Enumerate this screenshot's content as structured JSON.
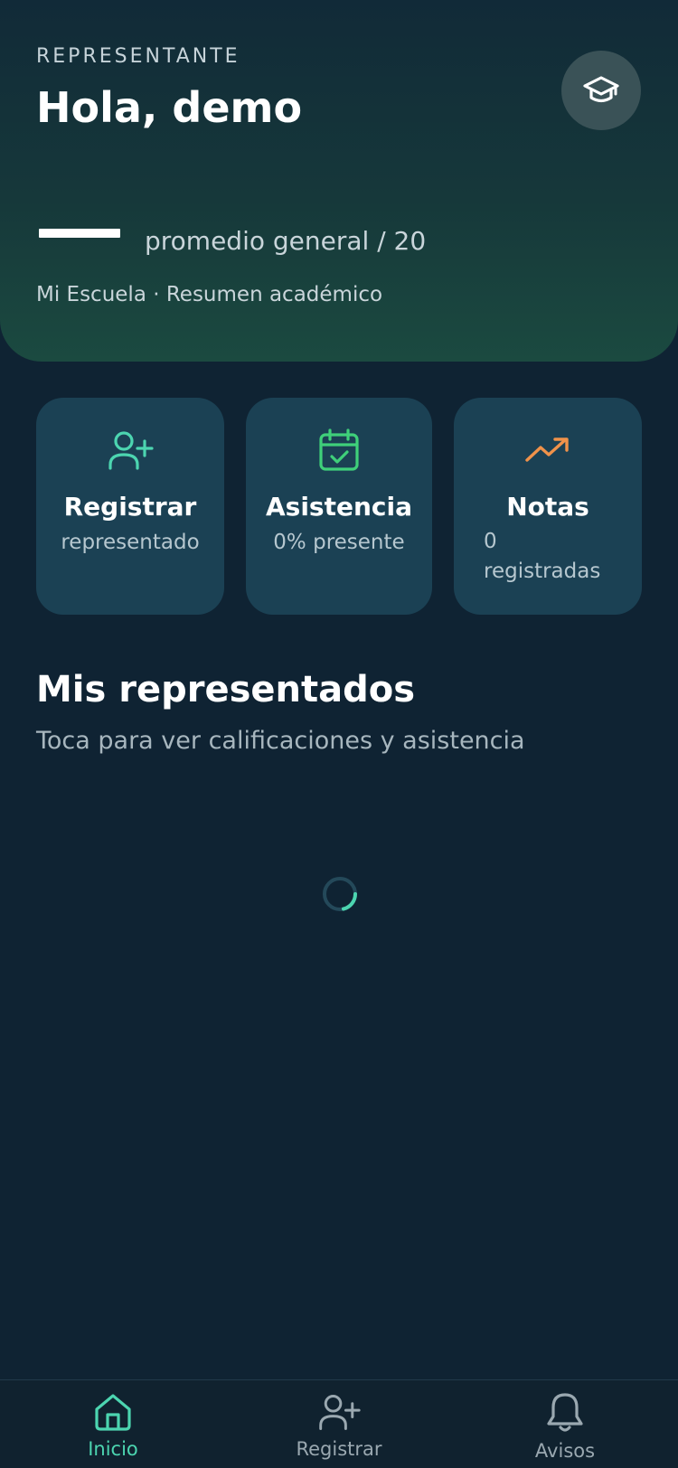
{
  "header": {
    "role": "REPRESENTANTE",
    "greeting": "Hola, demo",
    "average_label": "promedio general / 20",
    "school_line": "Mi Escuela · Resumen académico"
  },
  "cards": [
    {
      "title": "Registrar",
      "subtitle": "representado",
      "icon": "user-plus-icon",
      "color": "#4cd5b0"
    },
    {
      "title": "Asistencia",
      "subtitle": "0% presente",
      "icon": "calendar-check-icon",
      "color": "#3fd07a"
    },
    {
      "title": "Notas",
      "subtitle": "0 registradas",
      "icon": "trending-up-icon",
      "color": "#f0924a"
    }
  ],
  "section": {
    "title": "Mis representados",
    "subtitle": "Toca para ver calificaciones y asistencia"
  },
  "nav": [
    {
      "label": "Inicio",
      "icon": "home-icon",
      "active": true
    },
    {
      "label": "Registrar",
      "icon": "user-plus-icon",
      "active": false
    },
    {
      "label": "Avisos",
      "icon": "bell-icon",
      "active": false
    }
  ],
  "colors": {
    "background": "#0f2333",
    "card": "#1b4154",
    "accent": "#4cd5b0"
  }
}
